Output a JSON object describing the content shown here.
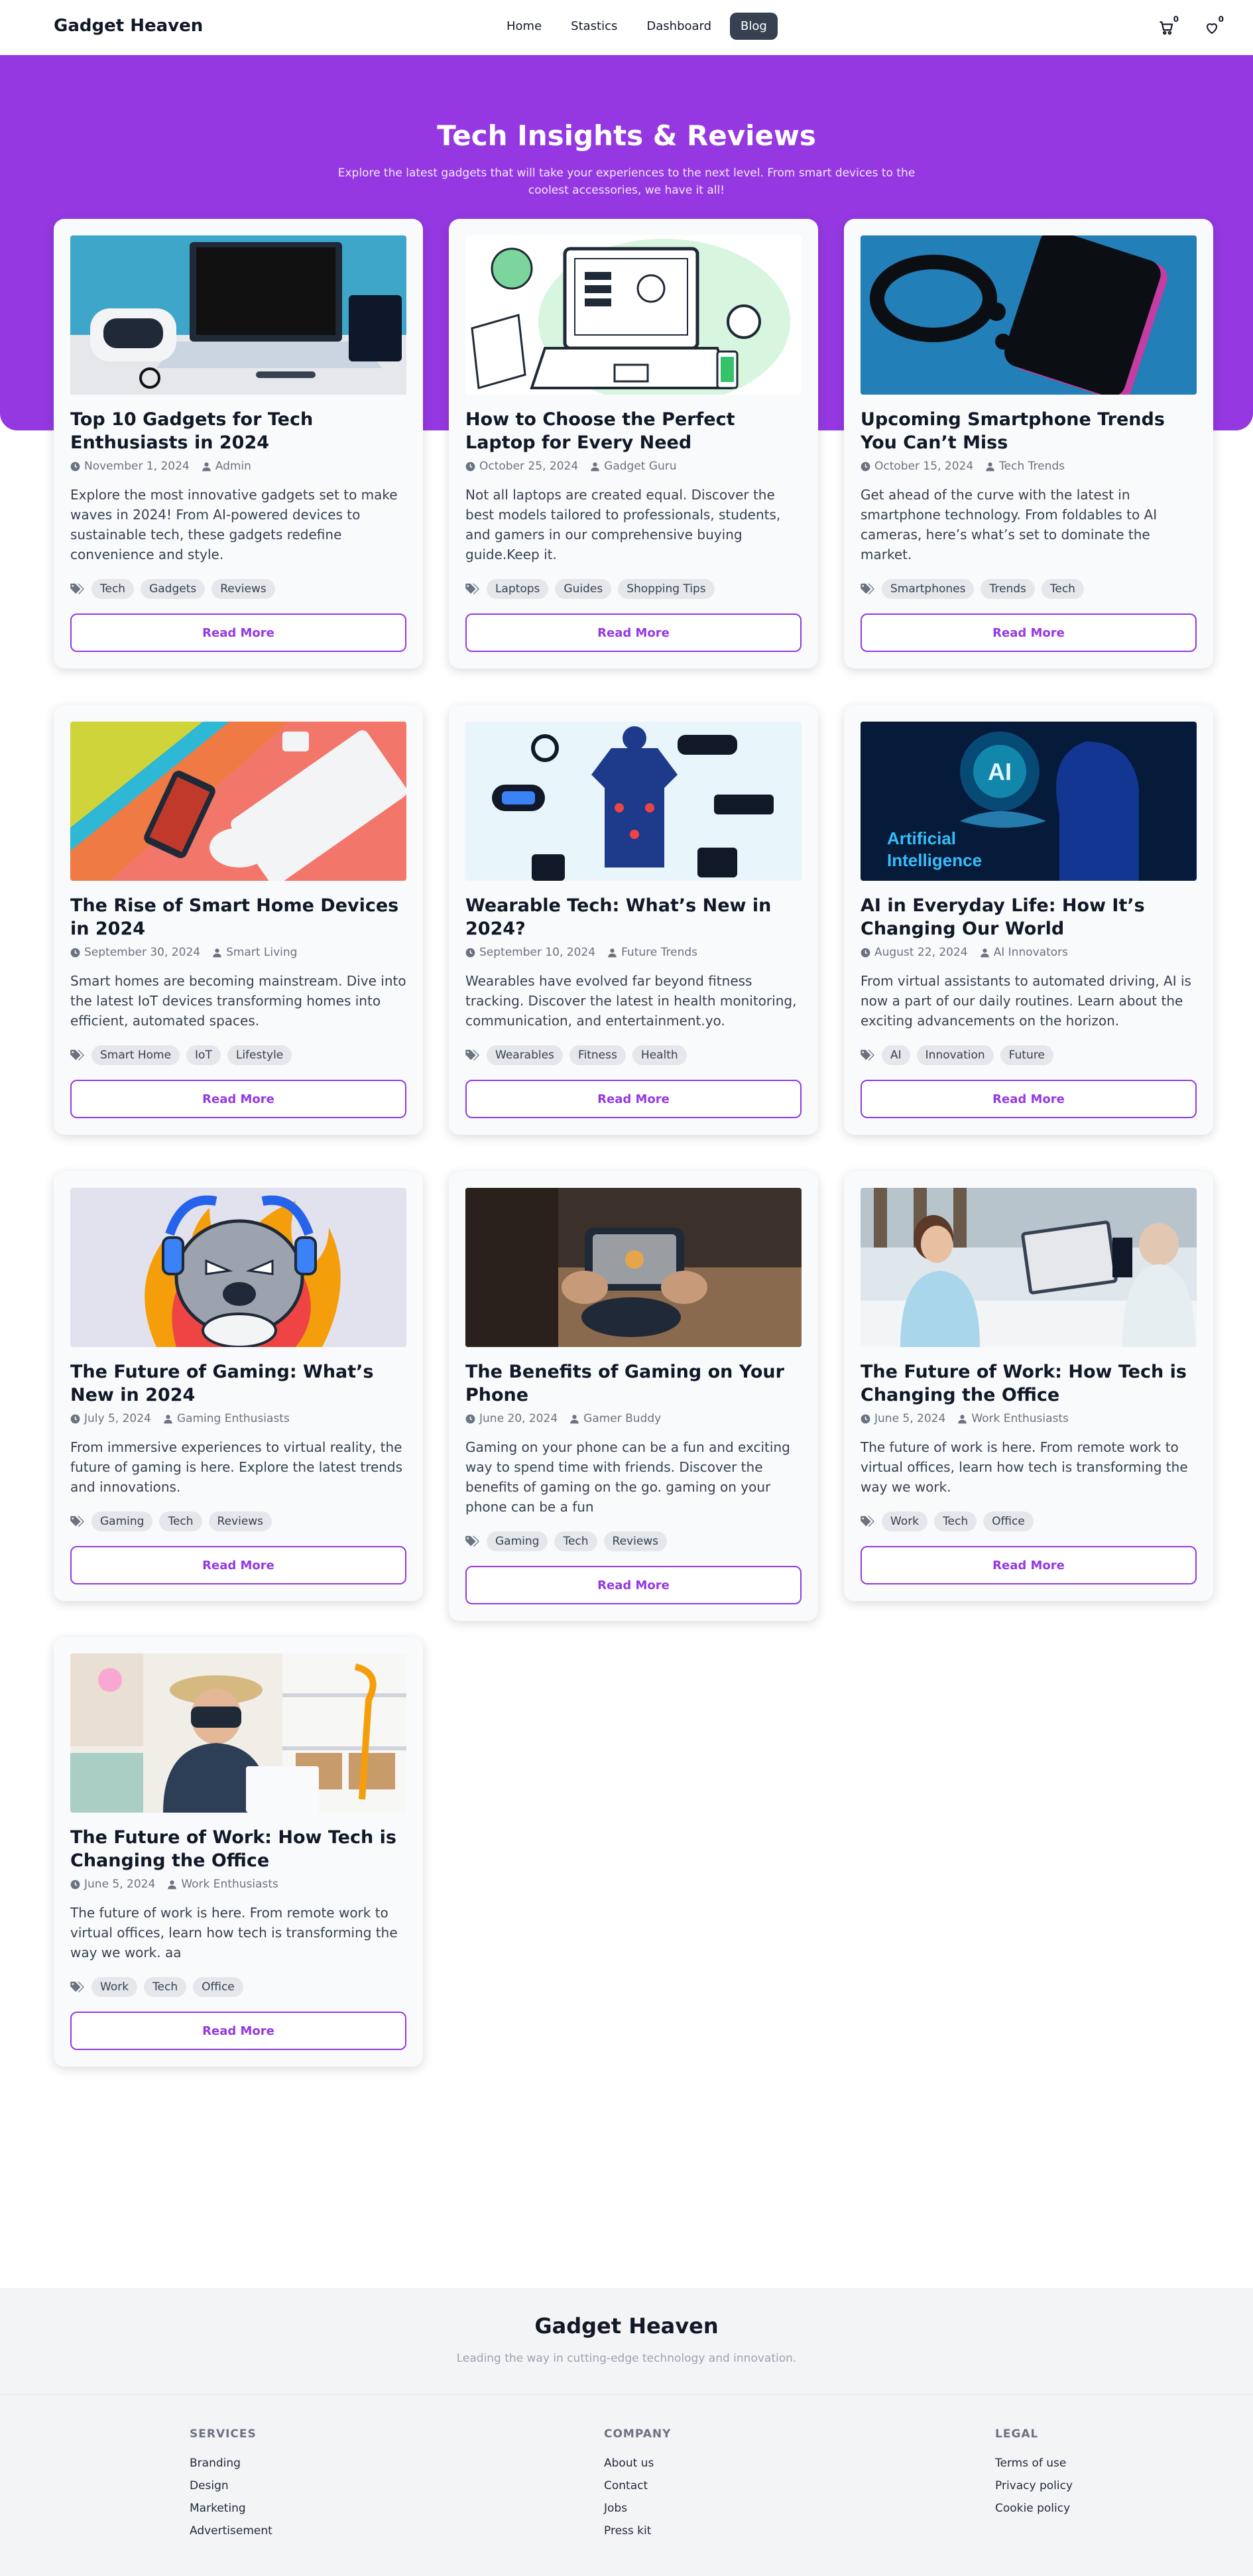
{
  "navbar": {
    "brand": "Gadget Heaven",
    "links": [
      "Home",
      "Stastics",
      "Dashboard",
      "Blog"
    ],
    "active_link": "Blog",
    "cart_count": "0",
    "wishlist_count": "0"
  },
  "hero": {
    "title": "Tech Insights & Reviews",
    "subtitle": "Explore the latest gadgets that will take your experiences to the next level. From smart devices to the coolest accessories, we have it all!"
  },
  "read_more_label": "Read More",
  "posts": [
    {
      "title": "Top 10 Gadgets for Tech Enthusiasts in 2024",
      "date": "November 1, 2024",
      "author": "Admin",
      "description": "Explore the most innovative gadgets set to make waves in 2024! From AI-powered devices to sustainable tech, these gadgets redefine convenience and style.",
      "tags": [
        "Tech",
        "Gadgets",
        "Reviews"
      ]
    },
    {
      "title": "How to Choose the Perfect Laptop for Every Need",
      "date": "October 25, 2024",
      "author": "Gadget Guru",
      "description": "Not all laptops are created equal. Discover the best models tailored to professionals, students, and gamers in our comprehensive buying guide.Keep it.",
      "tags": [
        "Laptops",
        "Guides",
        "Shopping Tips"
      ]
    },
    {
      "title": "Upcoming Smartphone Trends You Can’t Miss",
      "date": "October 15, 2024",
      "author": "Tech Trends",
      "description": "Get ahead of the curve with the latest in smartphone technology. From foldables to AI cameras, here’s what’s set to dominate the market.",
      "tags": [
        "Smartphones",
        "Trends",
        "Tech"
      ]
    },
    {
      "title": "The Rise of Smart Home Devices in 2024",
      "date": "September 30, 2024",
      "author": "Smart Living",
      "description": "Smart homes are becoming mainstream. Dive into the latest IoT devices transforming homes into efficient, automated spaces.",
      "tags": [
        "Smart Home",
        "IoT",
        "Lifestyle"
      ]
    },
    {
      "title": "Wearable Tech: What’s New in 2024?",
      "date": "September 10, 2024",
      "author": "Future Trends",
      "description": "Wearables have evolved far beyond fitness tracking. Discover the latest in health monitoring, communication, and entertainment.yo.",
      "tags": [
        "Wearables",
        "Fitness",
        "Health"
      ]
    },
    {
      "title": "AI in Everyday Life: How It’s Changing Our World",
      "date": "August 22, 2024",
      "author": "AI Innovators",
      "description": "From virtual assistants to automated driving, AI is now a part of our daily routines. Learn about the exciting advancements on the horizon.",
      "tags": [
        "AI",
        "Innovation",
        "Future"
      ]
    },
    {
      "title": "The Future of Gaming: What’s New in 2024",
      "date": "July 5, 2024",
      "author": "Gaming Enthusiasts",
      "description": "From immersive experiences to virtual reality, the future of gaming is here. Explore the latest trends and innovations.",
      "tags": [
        "Gaming",
        "Tech",
        "Reviews"
      ]
    },
    {
      "title": "The Benefits of Gaming on Your Phone",
      "date": "June 20, 2024",
      "author": "Gamer Buddy",
      "description": "Gaming on your phone can be a fun and exciting way to spend time with friends. Discover the benefits of gaming on the go. gaming on your phone can be a fun",
      "tags": [
        "Gaming",
        "Tech",
        "Reviews"
      ]
    },
    {
      "title": "The Future of Work: How Tech is Changing the Office",
      "date": "June 5, 2024",
      "author": "Work Enthusiasts",
      "description": "The future of work is here. From remote work to virtual offices, learn how tech is transforming the way we work.",
      "tags": [
        "Work",
        "Tech",
        "Office"
      ]
    },
    {
      "title": "The Future of Work: How Tech is Changing the Office",
      "date": "June 5, 2024",
      "author": "Work Enthusiasts",
      "description": "The future of work is here. From remote work to virtual offices, learn how tech is transforming the way we work. aa",
      "tags": [
        "Work",
        "Tech",
        "Office"
      ]
    }
  ],
  "ai_image_text": [
    "AI",
    "Artificial",
    "Intelligence"
  ],
  "footer": {
    "brand": "Gadget Heaven",
    "tagline": "Leading the way in cutting-edge technology and innovation.",
    "columns": [
      {
        "heading": "SERVICES",
        "links": [
          "Branding",
          "Design",
          "Marketing",
          "Advertisement"
        ]
      },
      {
        "heading": "COMPANY",
        "links": [
          "About us",
          "Contact",
          "Jobs",
          "Press kit"
        ]
      },
      {
        "heading": "LEGAL",
        "links": [
          "Terms of use",
          "Privacy policy",
          "Cookie policy"
        ]
      }
    ]
  }
}
